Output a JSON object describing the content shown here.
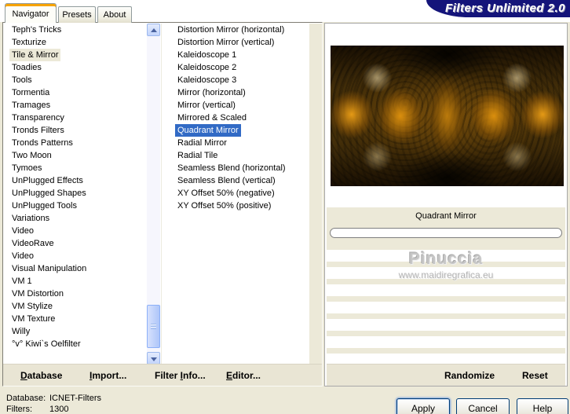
{
  "app": {
    "title": "Filters Unlimited 2.0"
  },
  "tabs": {
    "navigator": "Navigator",
    "presets": "Presets",
    "about": "About"
  },
  "left_list": {
    "selected_index": 2,
    "items": [
      "Teph's Tricks",
      "Texturize",
      "Tile & Mirror",
      "Toadies",
      "Tools",
      "Tormentia",
      "Tramages",
      "Transparency",
      "Tronds Filters",
      "Tronds Patterns",
      "Two Moon",
      "Tymoes",
      "UnPlugged Effects",
      "UnPlugged Shapes",
      "UnPlugged Tools",
      "Variations",
      "Video",
      "VideoRave",
      "Video",
      "Visual Manipulation",
      "VM 1",
      "VM Distortion",
      "VM Stylize",
      "VM Texture",
      "Willy",
      "°v° Kiwi`s Oelfilter"
    ]
  },
  "filter_list": {
    "selected_index": 8,
    "items": [
      "Distortion Mirror (horizontal)",
      "Distortion Mirror (vertical)",
      "Kaleidoscope 1",
      "Kaleidoscope 2",
      "Kaleidoscope 3",
      "Mirror (horizontal)",
      "Mirror (vertical)",
      "Mirrored & Scaled",
      "Quadrant Mirror",
      "Radial Mirror",
      "Radial Tile",
      "Seamless Blend (horizontal)",
      "Seamless Blend (vertical)",
      "XY Offset 50% (negative)",
      "XY Offset 50% (positive)"
    ]
  },
  "preview": {
    "selected_filter_label": "Quadrant Mirror",
    "progress_percent": 0,
    "watermark_title": "Pinuccia",
    "watermark_url": "www.maidiregrafica.eu",
    "randomize_label": "Randomize",
    "reset_label": "Reset"
  },
  "toolbar": {
    "database": {
      "pre": "",
      "key": "D",
      "rest": "atabase"
    },
    "import": {
      "pre": "",
      "key": "I",
      "rest": "mport..."
    },
    "filter_info": {
      "pre": "Filter ",
      "key": "I",
      "rest": "nfo..."
    },
    "editor": {
      "pre": "",
      "key": "E",
      "rest": "ditor..."
    }
  },
  "status": {
    "database_label": "Database:",
    "database_value": "ICNET-Filters",
    "filters_label": "Filters:",
    "filters_value": "1300"
  },
  "buttons": {
    "apply": "Apply",
    "cancel": "Cancel",
    "help": "Help"
  },
  "colors": {
    "selection_blue": "#316ac5",
    "banner_navy": "#14147a",
    "tab_accent_orange": "#f7a300",
    "dialog_beige": "#ece9d8",
    "preview_amber": "#b97a08"
  }
}
